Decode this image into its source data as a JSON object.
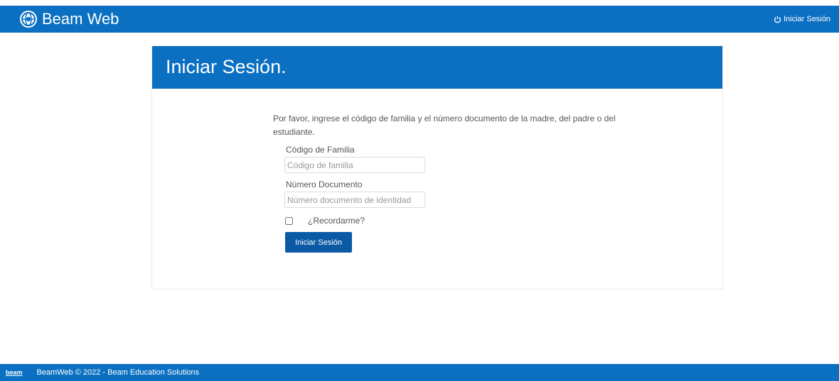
{
  "navbar": {
    "brand": "Beam Web",
    "login_link": "Iniciar Sesión",
    "color": "#0b70c2"
  },
  "card": {
    "title": "Iniciar Sesión.",
    "intro": "Por favor, ingrese el código de familia y el número documento de la madre, del padre o del estudiante.",
    "family_code_label": "Código de Familia",
    "family_code_placeholder": "Código de familia",
    "family_code_value": "",
    "document_label": "Número Documento",
    "document_placeholder": "Número documento de identidad",
    "document_value": "",
    "remember_label": "¿Recordarme?",
    "remember_checked": false,
    "submit_label": "Iniciar Sesión"
  },
  "footer": {
    "logo_text": "beam",
    "text": "BeamWeb © 2022 - Beam Education Solutions"
  }
}
